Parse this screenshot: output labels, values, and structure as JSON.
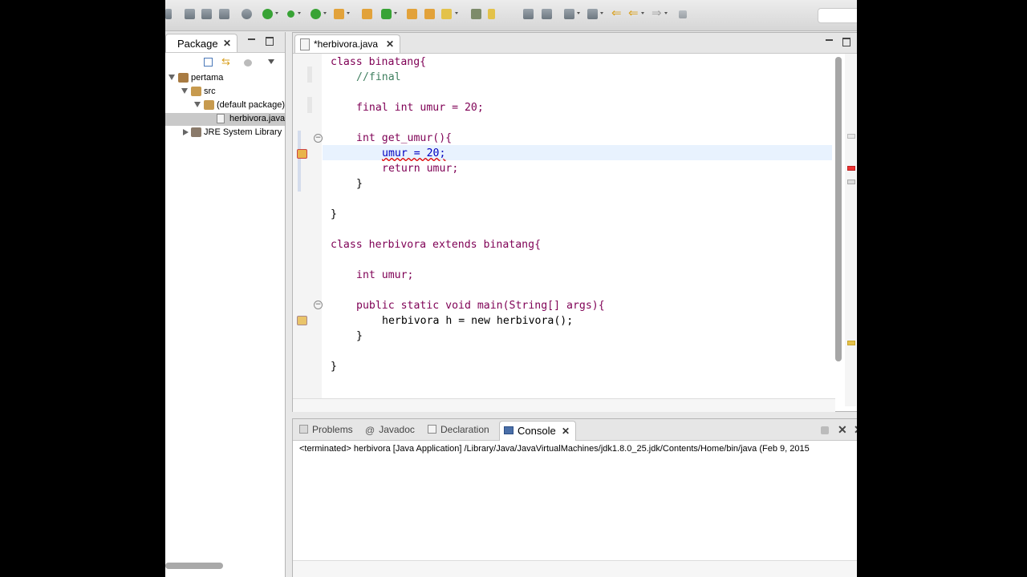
{
  "package_explorer": {
    "tab_label": "Package",
    "tree": [
      {
        "label": "pertama"
      },
      {
        "label": "src"
      },
      {
        "label": "(default package)"
      },
      {
        "label": "herbivora.java"
      },
      {
        "label": "JRE System Library"
      }
    ]
  },
  "editor": {
    "tab_label": "*herbivora.java",
    "lines": [
      "class binatang{",
      "//final",
      "final int umur = 20;",
      "int get_umur(){",
      "umur = 20;",
      "return umur;",
      "}",
      "}",
      "class herbivora extends binatang{",
      "int umur;",
      "public static void main(String[] args){",
      "herbivora h = new herbivora();",
      "}",
      "}"
    ]
  },
  "console": {
    "tabs": [
      "Problems",
      "Javadoc",
      "Declaration",
      "Console"
    ],
    "active_tab": "Console",
    "status": "<terminated> herbivora [Java Application] /Library/Java/JavaVirtualMachines/jdk1.8.0_25.jdk/Contents/Home/bin/java (Feb 9, 2015"
  },
  "colors": {
    "keyword": "#7f0055",
    "comment": "#3f7f5f",
    "field": "#0000c0",
    "current_line": "#e8f2fe"
  }
}
